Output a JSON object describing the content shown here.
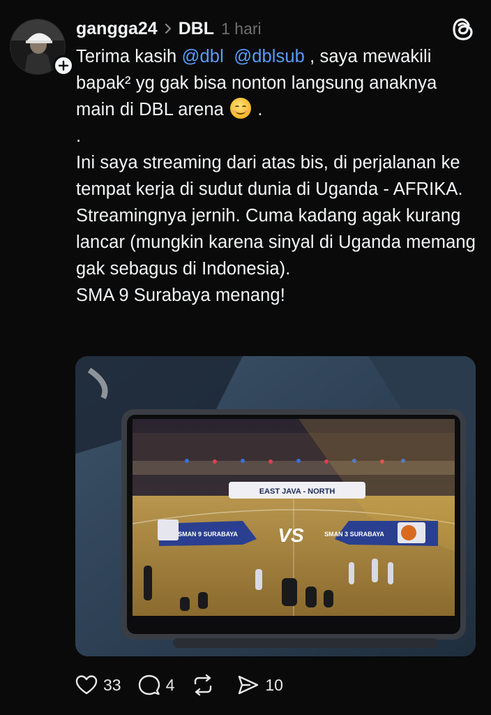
{
  "post": {
    "username": "gangga24",
    "community": "DBL",
    "time": "1 hari",
    "text": {
      "line1_prefix": "Terima kasih",
      "mention1": "@dbl",
      "mention2": "@dblsub",
      "line1_suffix": ", saya mewakili bapak² yg gak bisa nonton langsung anaknya main di DBL arena",
      "line1_end": ".",
      "dot_line": ".",
      "para2": "Ini saya streaming dari atas bis, di perjalanan ke tempat kerja di sudut dunia di Uganda - AFRIKA.",
      "para3": "Streamingnya jernih. Cuma kadang agak kurang lancar (mungkin karena sinyal di Uganda memang gak sebagus di Indonesia).",
      "para4": "SMA 9 Surabaya menang!"
    },
    "media": {
      "scoreboard_title": "EAST JAVA - NORTH",
      "team_left": "SMAN 9 SURABAYA",
      "vs": "VS",
      "team_right": "SMAN 3 SURABAYA"
    },
    "actions": {
      "likes": "33",
      "comments": "4",
      "shares": "10"
    }
  },
  "icons": {
    "follow": "plus-icon",
    "separator": "chevron-right-icon",
    "app": "threads-logo-icon",
    "like": "heart-icon",
    "comment": "comment-icon",
    "repost": "repost-icon",
    "share": "send-icon"
  },
  "colors": {
    "background": "#0a0a0a",
    "text": "#f3f5f7",
    "mention": "#5a9cf8",
    "muted": "#6f6f6f"
  }
}
